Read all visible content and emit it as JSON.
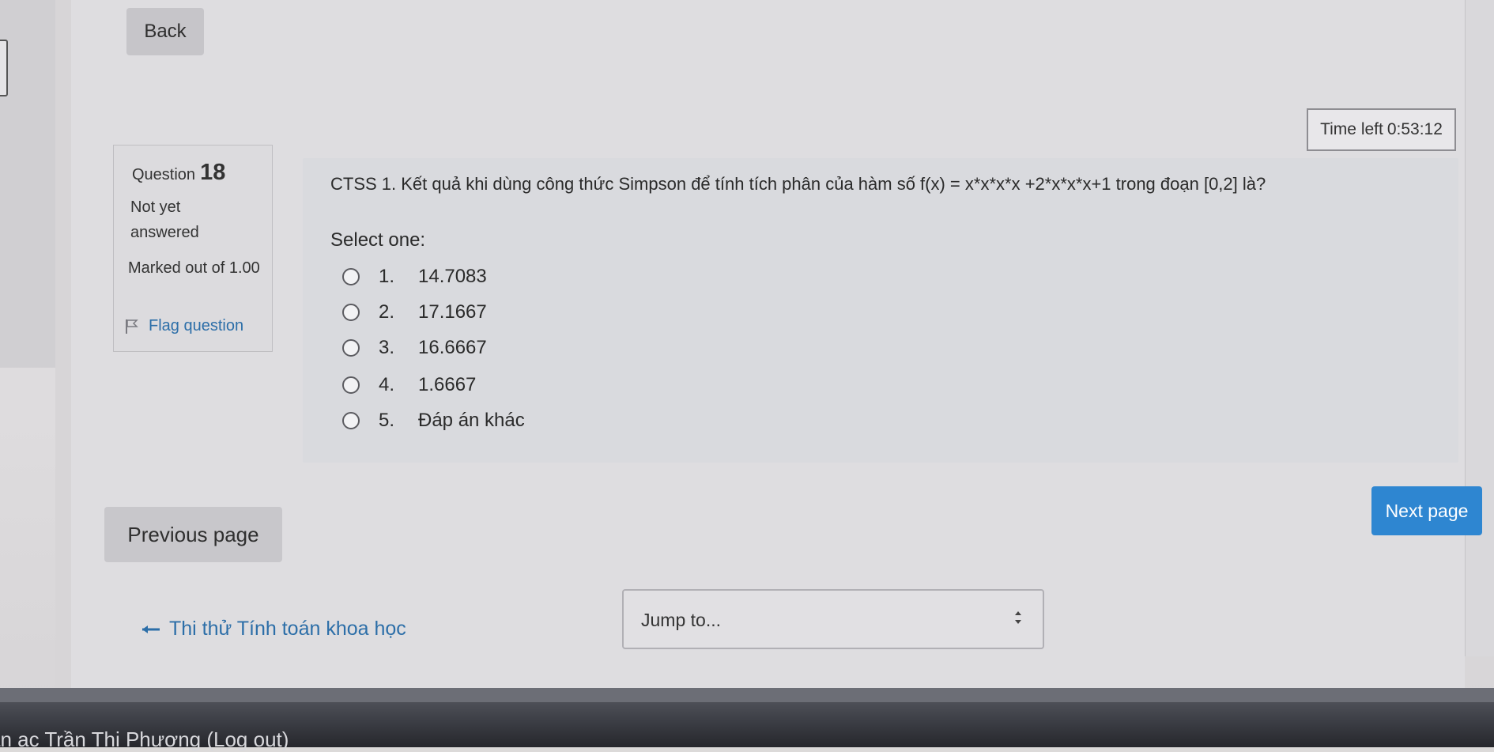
{
  "nav": {
    "back_label": "Back"
  },
  "timer": {
    "label": "Time left",
    "value": "0:53:12"
  },
  "question_info": {
    "label": "Question",
    "number": "18",
    "status": "Not yet answered",
    "marks": "Marked out of 1.00",
    "flag_label": "Flag question"
  },
  "question": {
    "text": "CTSS 1. Kết quả khi dùng công thức Simpson để tính tích phân của hàm số f(x) = x*x*x*x +2*x*x*x+1 trong đoạn [0,2] là?",
    "select_label": "Select one:",
    "options": [
      {
        "num": "1.",
        "text": "14.7083"
      },
      {
        "num": "2.",
        "text": "17.1667"
      },
      {
        "num": "3.",
        "text": "16.6667"
      },
      {
        "num": "4.",
        "text": "1.6667"
      },
      {
        "num": "5.",
        "text": "Đáp án khác"
      }
    ]
  },
  "pagination": {
    "next_label": "Next page",
    "previous_label": "Previous page"
  },
  "course_link": {
    "label": "Thi thử Tính toán khoa học"
  },
  "jump": {
    "label": "Jump to..."
  },
  "footer": {
    "text": "ăn ac Trần Thị Phương (Log out)"
  },
  "colors": {
    "link": "#2c6ea8",
    "primary_button": "#2e86d1"
  }
}
